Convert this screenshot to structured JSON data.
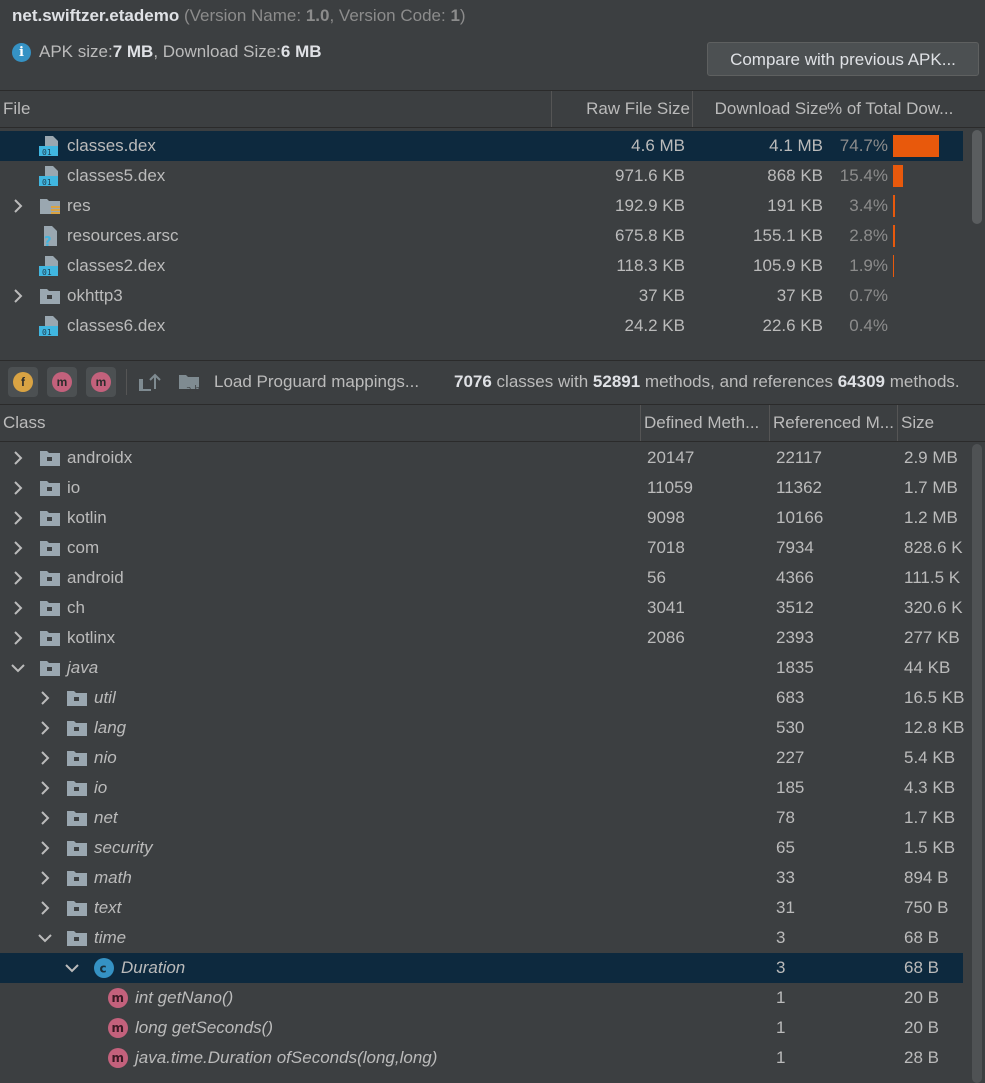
{
  "header": {
    "app_id": "net.swiftzer.etademo",
    "version_prefix": " (Version Name: ",
    "version_name": "1.0",
    "version_mid": ", Version Code: ",
    "version_code": "1",
    "version_suffix": ")",
    "apk_size_label": "APK size: ",
    "apk_size_value": "7 MB",
    "download_label": ", Download Size: ",
    "download_value": "6 MB",
    "compare_button": "Compare with previous APK..."
  },
  "file_table": {
    "columns": [
      "File",
      "Raw File Size",
      "Download Size",
      "% of Total Dow..."
    ],
    "rows": [
      {
        "name": "classes.dex",
        "icon": "dex-file-icon",
        "expandable": false,
        "raw": "4.6 MB",
        "download": "4.1 MB",
        "percent": "74.7%",
        "fraction": 0.747,
        "selected": true
      },
      {
        "name": "classes5.dex",
        "icon": "dex-file-icon",
        "expandable": false,
        "raw": "971.6 KB",
        "download": "868 KB",
        "percent": "15.4%",
        "fraction": 0.154,
        "selected": false
      },
      {
        "name": "res",
        "icon": "res-folder-icon",
        "expandable": true,
        "raw": "192.9 KB",
        "download": "191 KB",
        "percent": "3.4%",
        "fraction": 0.034,
        "selected": false
      },
      {
        "name": "resources.arsc",
        "icon": "unknown-file-icon",
        "expandable": false,
        "raw": "675.8 KB",
        "download": "155.1 KB",
        "percent": "2.8%",
        "fraction": 0.028,
        "selected": false
      },
      {
        "name": "classes2.dex",
        "icon": "dex-file-icon",
        "expandable": false,
        "raw": "118.3 KB",
        "download": "105.9 KB",
        "percent": "1.9%",
        "fraction": 0.019,
        "selected": false
      },
      {
        "name": "okhttp3",
        "icon": "folder-icon",
        "expandable": true,
        "raw": "37 KB",
        "download": "37 KB",
        "percent": "0.7%",
        "fraction": 0.007,
        "selected": false
      },
      {
        "name": "classes6.dex",
        "icon": "dex-file-icon",
        "expandable": false,
        "raw": "24.2 KB",
        "download": "22.6 KB",
        "percent": "0.4%",
        "fraction": 0.004,
        "selected": false
      }
    ]
  },
  "toolbar": {
    "buttons": [
      {
        "name": "show-fields-button",
        "letter": "f",
        "color": "#d9a343"
      },
      {
        "name": "show-methods-button",
        "letter": "m",
        "color": "#c3617c"
      },
      {
        "name": "show-referenced-button",
        "letter": "m",
        "color": "#c3617c"
      }
    ],
    "load_proguard": "Load Proguard mappings...",
    "summary": {
      "classes": "7076",
      "classes_text": " classes with ",
      "methods": "52891",
      "methods_text": " methods, and references ",
      "refs": "64309",
      "refs_text": " methods."
    }
  },
  "class_table": {
    "columns": [
      "Class",
      "Defined Meth...",
      "Referenced M...",
      "Size"
    ],
    "rows": [
      {
        "name": "androidx",
        "level": 0,
        "type": "package",
        "arrow": "right",
        "defined": "20147",
        "referenced": "22117",
        "size": "2.9 MB",
        "italic": false
      },
      {
        "name": "io",
        "level": 0,
        "type": "package",
        "arrow": "right",
        "defined": "11059",
        "referenced": "11362",
        "size": "1.7 MB",
        "italic": false
      },
      {
        "name": "kotlin",
        "level": 0,
        "type": "package",
        "arrow": "right",
        "defined": "9098",
        "referenced": "10166",
        "size": "1.2 MB",
        "italic": false
      },
      {
        "name": "com",
        "level": 0,
        "type": "package",
        "arrow": "right",
        "defined": "7018",
        "referenced": "7934",
        "size": "828.6 K",
        "italic": false
      },
      {
        "name": "android",
        "level": 0,
        "type": "package",
        "arrow": "right",
        "defined": "56",
        "referenced": "4366",
        "size": "111.5 K",
        "italic": false
      },
      {
        "name": "ch",
        "level": 0,
        "type": "package",
        "arrow": "right",
        "defined": "3041",
        "referenced": "3512",
        "size": "320.6 K",
        "italic": false
      },
      {
        "name": "kotlinx",
        "level": 0,
        "type": "package",
        "arrow": "right",
        "defined": "2086",
        "referenced": "2393",
        "size": "277 KB",
        "italic": false
      },
      {
        "name": "java",
        "level": 0,
        "type": "package",
        "arrow": "down",
        "defined": "",
        "referenced": "1835",
        "size": "44 KB",
        "italic": true
      },
      {
        "name": "util",
        "level": 1,
        "type": "package",
        "arrow": "right",
        "defined": "",
        "referenced": "683",
        "size": "16.5 KB",
        "italic": true
      },
      {
        "name": "lang",
        "level": 1,
        "type": "package",
        "arrow": "right",
        "defined": "",
        "referenced": "530",
        "size": "12.8 KB",
        "italic": true
      },
      {
        "name": "nio",
        "level": 1,
        "type": "package",
        "arrow": "right",
        "defined": "",
        "referenced": "227",
        "size": "5.4 KB",
        "italic": true
      },
      {
        "name": "io",
        "level": 1,
        "type": "package",
        "arrow": "right",
        "defined": "",
        "referenced": "185",
        "size": "4.3 KB",
        "italic": true
      },
      {
        "name": "net",
        "level": 1,
        "type": "package",
        "arrow": "right",
        "defined": "",
        "referenced": "78",
        "size": "1.7 KB",
        "italic": true
      },
      {
        "name": "security",
        "level": 1,
        "type": "package",
        "arrow": "right",
        "defined": "",
        "referenced": "65",
        "size": "1.5 KB",
        "italic": true
      },
      {
        "name": "math",
        "level": 1,
        "type": "package",
        "arrow": "right",
        "defined": "",
        "referenced": "33",
        "size": "894 B",
        "italic": true
      },
      {
        "name": "text",
        "level": 1,
        "type": "package",
        "arrow": "right",
        "defined": "",
        "referenced": "31",
        "size": "750 B",
        "italic": true
      },
      {
        "name": "time",
        "level": 1,
        "type": "package",
        "arrow": "down",
        "defined": "",
        "referenced": "3",
        "size": "68 B",
        "italic": true
      },
      {
        "name": "Duration",
        "level": 2,
        "type": "class",
        "arrow": "down",
        "defined": "",
        "referenced": "3",
        "size": "68 B",
        "italic": true,
        "selected": true
      },
      {
        "name": "int getNano()",
        "level": 3,
        "type": "method",
        "arrow": "none",
        "defined": "",
        "referenced": "1",
        "size": "20 B",
        "italic": true
      },
      {
        "name": "long getSeconds()",
        "level": 3,
        "type": "method",
        "arrow": "none",
        "defined": "",
        "referenced": "1",
        "size": "20 B",
        "italic": true
      },
      {
        "name": "java.time.Duration ofSeconds(long,long)",
        "level": 3,
        "type": "method",
        "arrow": "none",
        "defined": "",
        "referenced": "1",
        "size": "28 B",
        "italic": true
      }
    ]
  },
  "colors": {
    "background": "#3c3f41",
    "selection": "#0d293e",
    "bar": "#e8590c",
    "folder_icon": "#9aa7b0",
    "dex_icon": "#40b6e0",
    "class_icon": "#3592c4",
    "method_icon": "#c3617c"
  }
}
